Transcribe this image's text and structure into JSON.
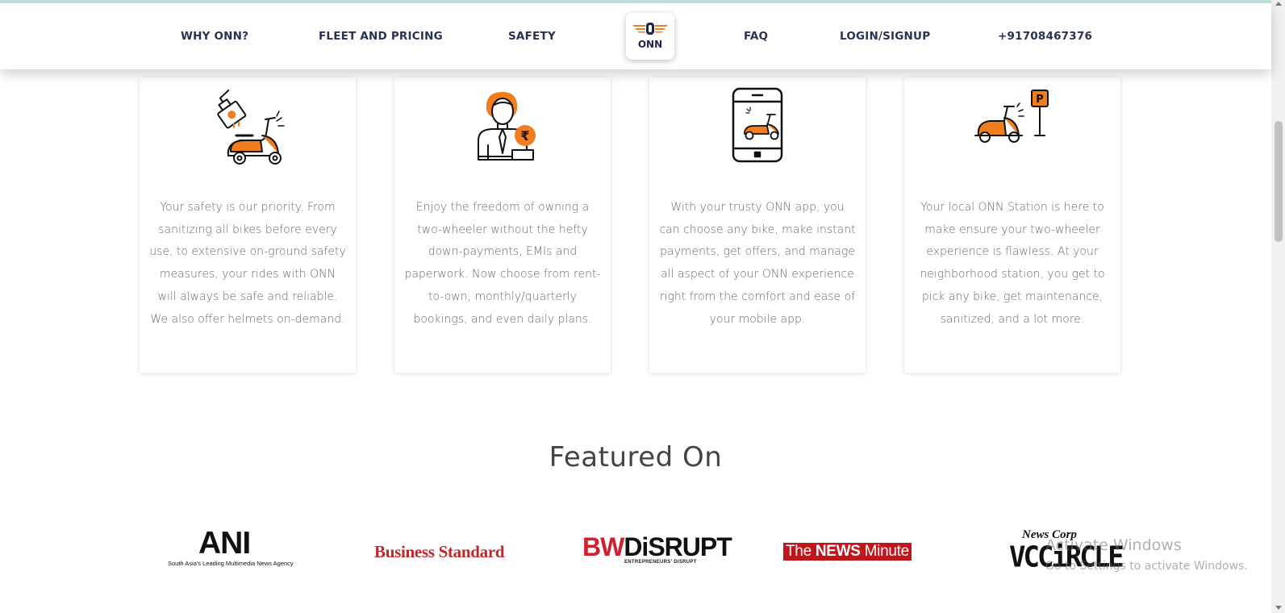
{
  "nav": {
    "items": [
      "WHY ONN?",
      "FLEET AND PRICING",
      "SAFETY",
      "FAQ",
      "LOGIN/SIGNUP",
      "+91708467376"
    ],
    "logo_text": "ONN"
  },
  "cards": [
    {
      "icon": "sanitizer-scooter-icon",
      "text": "Your safety is our priority. From sanitizing all bikes before every use, to extensive on-ground safety measures, your rides with ONN will always be safe and reliable. We also offer helmets on-demand."
    },
    {
      "icon": "owner-rupee-icon",
      "text": "Enjoy the freedom of owning a two-wheeler without the hefty down-payments, EMIs and paperwork. Now choose from rent-to-own, monthly/quarterly bookings, and even daily plans."
    },
    {
      "icon": "mobile-app-scooter-icon",
      "text": "With your trusty ONN app, you can choose any bike, make instant payments, get offers, and manage all aspect of your ONN experience right from the comfort and ease of your mobile app."
    },
    {
      "icon": "parking-station-scooter-icon",
      "text": "Your local ONN Station is here to make ensure your two-wheeler experience is flawless. At your neighborhood station, you get to pick any bike, get maintenance, sanitized, and a lot more."
    }
  ],
  "featured": {
    "title": "Featured On",
    "ani": {
      "main": "ANI",
      "sub": "South Asia's Leading Multimedia News Agency"
    },
    "business_standard": "Business Standard",
    "bw_disrupt": {
      "bw": "BW",
      "disrupt": "DiSRUPT",
      "sub": "ENTREPRENEURS' DISRUPT"
    },
    "news_minute": {
      "the": "The ",
      "news": "NEWS",
      "minute": " Minute"
    },
    "vccircle": {
      "top": "News Corp",
      "main": "VCCiRCLE"
    }
  },
  "watermark": {
    "line1": "Activate Windows",
    "line2": "Go to Settings to activate Windows."
  },
  "colors": {
    "accent_orange": "#f07d1e",
    "nav_text": "#2a3152",
    "body_text": "#6a6a6a"
  }
}
